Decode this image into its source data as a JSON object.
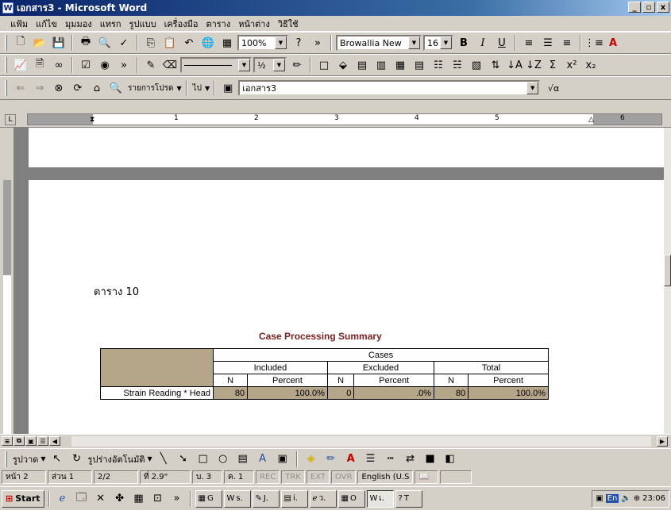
{
  "window": {
    "title": "เอกสาร3 - Microsoft Word",
    "min_label": "_",
    "max_label": "▫",
    "close_label": "x"
  },
  "menu": [
    "แฟ้ม",
    "แก้ไข",
    "มุมมอง",
    "แทรก",
    "รูปแบบ",
    "เครื่องมือ",
    "ตาราง",
    "หน้าต่าง",
    "วิธีใช้"
  ],
  "toolbar": {
    "zoom": "100%",
    "font": "Browallia New",
    "size": "16",
    "bold": "B",
    "italic": "I",
    "underline": "U",
    "fraction": "½"
  },
  "web_toolbar": {
    "favorites": "รายการโปรด",
    "go": "ไป",
    "address": "เอกสาร3"
  },
  "ruler": {
    "marks": [
      "1",
      "2",
      "3",
      "4",
      "5",
      "6"
    ]
  },
  "document": {
    "table_caption": "ตาราง 10",
    "summary_title": "Case Processing Summary",
    "table": {
      "cases_header": "Cases",
      "groups": [
        "Included",
        "Excluded",
        "Total"
      ],
      "subheaders": [
        "N",
        "Percent",
        "N",
        "Percent",
        "N",
        "Percent"
      ],
      "row_label": "Strain Reading * Head",
      "row_values": [
        "80",
        "100.0%",
        "0",
        ".0%",
        "80",
        "100.0%"
      ]
    }
  },
  "drawing": {
    "draw_label": "รูปวาด",
    "autoshapes_label": "รูปร่างอัตโนมัติ"
  },
  "status": {
    "page": "หน้า 2",
    "section": "ส่วน 1",
    "pages": "2/2",
    "at": "ที่ 2.9\"",
    "line": "บ. 3",
    "col": "ค. 1",
    "rec": "REC",
    "trk": "TRK",
    "ext": "EXT",
    "ovr": "OVR",
    "language": "English (U.S"
  },
  "taskbar": {
    "start": "Start",
    "buttons": [
      "G",
      "s.",
      "J.",
      "i.",
      "ว.",
      "O",
      "เ.",
      "T"
    ],
    "clock": "23:06",
    "lang": "En"
  },
  "colors": {
    "title_start": "#0a246a",
    "title_end": "#a6caf0",
    "table_fill": "#b5a589",
    "summary_title": "#7a1f1f"
  }
}
